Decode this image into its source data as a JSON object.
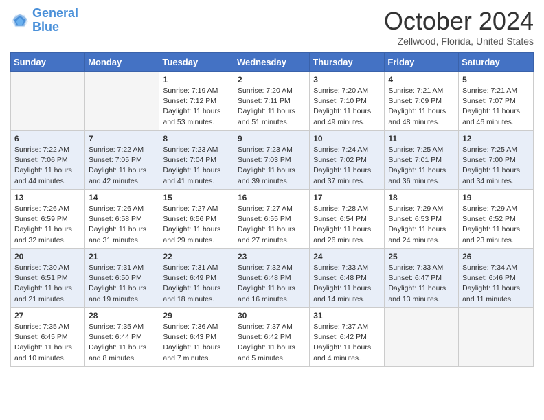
{
  "header": {
    "logo_line1": "General",
    "logo_line2": "Blue",
    "month": "October 2024",
    "location": "Zellwood, Florida, United States"
  },
  "weekdays": [
    "Sunday",
    "Monday",
    "Tuesday",
    "Wednesday",
    "Thursday",
    "Friday",
    "Saturday"
  ],
  "weeks": [
    [
      {
        "day": "",
        "sunrise": "",
        "sunset": "",
        "daylight": ""
      },
      {
        "day": "",
        "sunrise": "",
        "sunset": "",
        "daylight": ""
      },
      {
        "day": "1",
        "sunrise": "Sunrise: 7:19 AM",
        "sunset": "Sunset: 7:12 PM",
        "daylight": "Daylight: 11 hours and 53 minutes."
      },
      {
        "day": "2",
        "sunrise": "Sunrise: 7:20 AM",
        "sunset": "Sunset: 7:11 PM",
        "daylight": "Daylight: 11 hours and 51 minutes."
      },
      {
        "day": "3",
        "sunrise": "Sunrise: 7:20 AM",
        "sunset": "Sunset: 7:10 PM",
        "daylight": "Daylight: 11 hours and 49 minutes."
      },
      {
        "day": "4",
        "sunrise": "Sunrise: 7:21 AM",
        "sunset": "Sunset: 7:09 PM",
        "daylight": "Daylight: 11 hours and 48 minutes."
      },
      {
        "day": "5",
        "sunrise": "Sunrise: 7:21 AM",
        "sunset": "Sunset: 7:07 PM",
        "daylight": "Daylight: 11 hours and 46 minutes."
      }
    ],
    [
      {
        "day": "6",
        "sunrise": "Sunrise: 7:22 AM",
        "sunset": "Sunset: 7:06 PM",
        "daylight": "Daylight: 11 hours and 44 minutes."
      },
      {
        "day": "7",
        "sunrise": "Sunrise: 7:22 AM",
        "sunset": "Sunset: 7:05 PM",
        "daylight": "Daylight: 11 hours and 42 minutes."
      },
      {
        "day": "8",
        "sunrise": "Sunrise: 7:23 AM",
        "sunset": "Sunset: 7:04 PM",
        "daylight": "Daylight: 11 hours and 41 minutes."
      },
      {
        "day": "9",
        "sunrise": "Sunrise: 7:23 AM",
        "sunset": "Sunset: 7:03 PM",
        "daylight": "Daylight: 11 hours and 39 minutes."
      },
      {
        "day": "10",
        "sunrise": "Sunrise: 7:24 AM",
        "sunset": "Sunset: 7:02 PM",
        "daylight": "Daylight: 11 hours and 37 minutes."
      },
      {
        "day": "11",
        "sunrise": "Sunrise: 7:25 AM",
        "sunset": "Sunset: 7:01 PM",
        "daylight": "Daylight: 11 hours and 36 minutes."
      },
      {
        "day": "12",
        "sunrise": "Sunrise: 7:25 AM",
        "sunset": "Sunset: 7:00 PM",
        "daylight": "Daylight: 11 hours and 34 minutes."
      }
    ],
    [
      {
        "day": "13",
        "sunrise": "Sunrise: 7:26 AM",
        "sunset": "Sunset: 6:59 PM",
        "daylight": "Daylight: 11 hours and 32 minutes."
      },
      {
        "day": "14",
        "sunrise": "Sunrise: 7:26 AM",
        "sunset": "Sunset: 6:58 PM",
        "daylight": "Daylight: 11 hours and 31 minutes."
      },
      {
        "day": "15",
        "sunrise": "Sunrise: 7:27 AM",
        "sunset": "Sunset: 6:56 PM",
        "daylight": "Daylight: 11 hours and 29 minutes."
      },
      {
        "day": "16",
        "sunrise": "Sunrise: 7:27 AM",
        "sunset": "Sunset: 6:55 PM",
        "daylight": "Daylight: 11 hours and 27 minutes."
      },
      {
        "day": "17",
        "sunrise": "Sunrise: 7:28 AM",
        "sunset": "Sunset: 6:54 PM",
        "daylight": "Daylight: 11 hours and 26 minutes."
      },
      {
        "day": "18",
        "sunrise": "Sunrise: 7:29 AM",
        "sunset": "Sunset: 6:53 PM",
        "daylight": "Daylight: 11 hours and 24 minutes."
      },
      {
        "day": "19",
        "sunrise": "Sunrise: 7:29 AM",
        "sunset": "Sunset: 6:52 PM",
        "daylight": "Daylight: 11 hours and 23 minutes."
      }
    ],
    [
      {
        "day": "20",
        "sunrise": "Sunrise: 7:30 AM",
        "sunset": "Sunset: 6:51 PM",
        "daylight": "Daylight: 11 hours and 21 minutes."
      },
      {
        "day": "21",
        "sunrise": "Sunrise: 7:31 AM",
        "sunset": "Sunset: 6:50 PM",
        "daylight": "Daylight: 11 hours and 19 minutes."
      },
      {
        "day": "22",
        "sunrise": "Sunrise: 7:31 AM",
        "sunset": "Sunset: 6:49 PM",
        "daylight": "Daylight: 11 hours and 18 minutes."
      },
      {
        "day": "23",
        "sunrise": "Sunrise: 7:32 AM",
        "sunset": "Sunset: 6:48 PM",
        "daylight": "Daylight: 11 hours and 16 minutes."
      },
      {
        "day": "24",
        "sunrise": "Sunrise: 7:33 AM",
        "sunset": "Sunset: 6:48 PM",
        "daylight": "Daylight: 11 hours and 14 minutes."
      },
      {
        "day": "25",
        "sunrise": "Sunrise: 7:33 AM",
        "sunset": "Sunset: 6:47 PM",
        "daylight": "Daylight: 11 hours and 13 minutes."
      },
      {
        "day": "26",
        "sunrise": "Sunrise: 7:34 AM",
        "sunset": "Sunset: 6:46 PM",
        "daylight": "Daylight: 11 hours and 11 minutes."
      }
    ],
    [
      {
        "day": "27",
        "sunrise": "Sunrise: 7:35 AM",
        "sunset": "Sunset: 6:45 PM",
        "daylight": "Daylight: 11 hours and 10 minutes."
      },
      {
        "day": "28",
        "sunrise": "Sunrise: 7:35 AM",
        "sunset": "Sunset: 6:44 PM",
        "daylight": "Daylight: 11 hours and 8 minutes."
      },
      {
        "day": "29",
        "sunrise": "Sunrise: 7:36 AM",
        "sunset": "Sunset: 6:43 PM",
        "daylight": "Daylight: 11 hours and 7 minutes."
      },
      {
        "day": "30",
        "sunrise": "Sunrise: 7:37 AM",
        "sunset": "Sunset: 6:42 PM",
        "daylight": "Daylight: 11 hours and 5 minutes."
      },
      {
        "day": "31",
        "sunrise": "Sunrise: 7:37 AM",
        "sunset": "Sunset: 6:42 PM",
        "daylight": "Daylight: 11 hours and 4 minutes."
      },
      {
        "day": "",
        "sunrise": "",
        "sunset": "",
        "daylight": ""
      },
      {
        "day": "",
        "sunrise": "",
        "sunset": "",
        "daylight": ""
      }
    ]
  ]
}
